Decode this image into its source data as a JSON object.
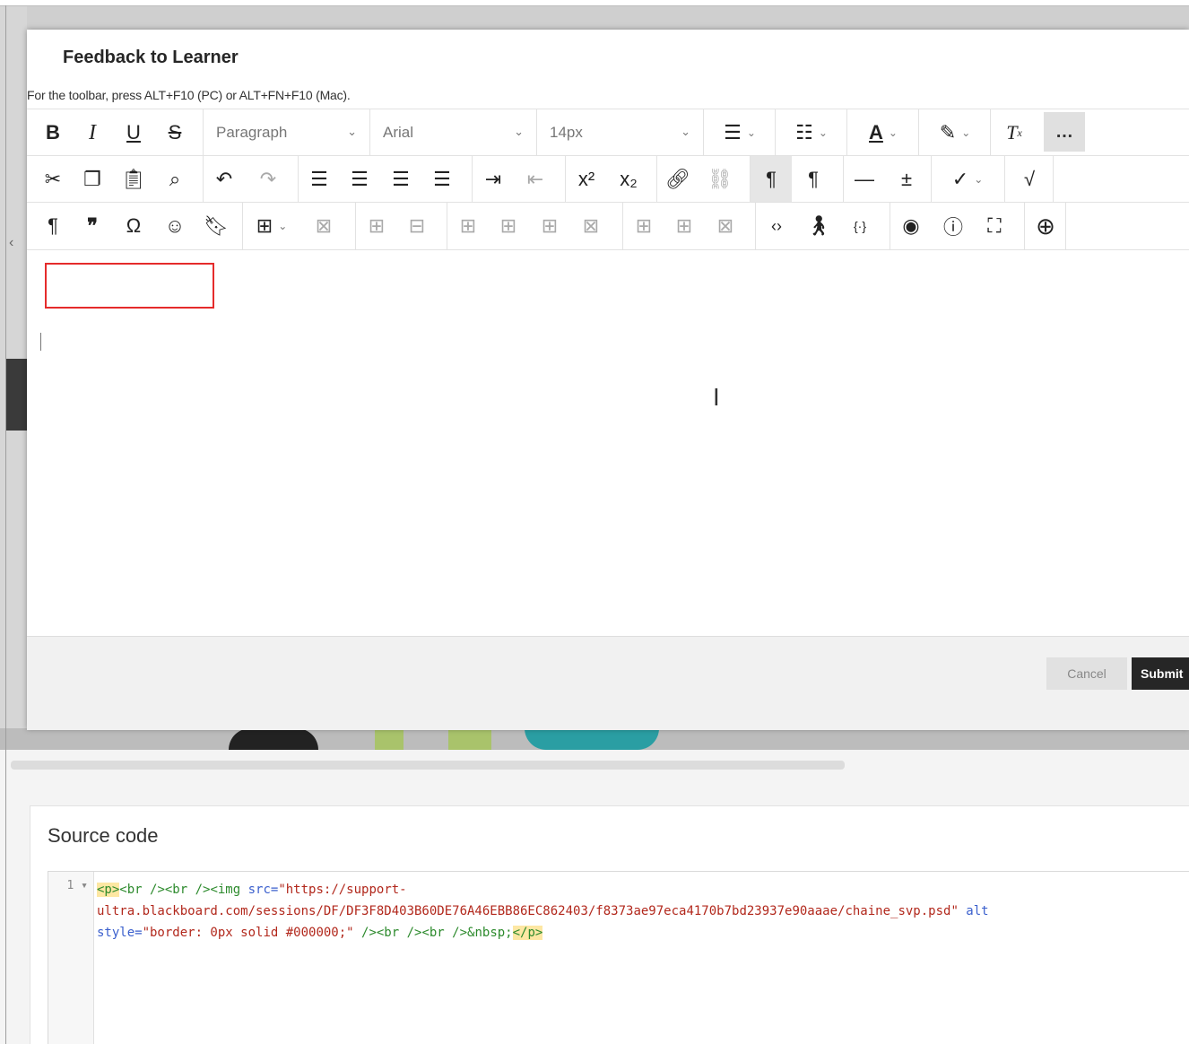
{
  "modal": {
    "title": "Feedback to Learner",
    "toolbar_hint": "For the toolbar, press ALT+F10 (PC) or ALT+FN+F10 (Mac).",
    "format_select": "Paragraph",
    "font_select": "Arial",
    "size_select": "14px",
    "more_label": "…",
    "cancel_label": "Cancel",
    "submit_label": "Submit"
  },
  "source": {
    "title": "Source code",
    "line_number": "1",
    "code": {
      "line1": {
        "open_p": "<p>",
        "br_tags": "<br /><br /><img ",
        "src_attr": "src=",
        "src_val_start": "\"https://support-"
      },
      "line2": {
        "src_val_end": "ultra.blackboard.com/sessions/DF/DF3F8D403B60DE76A46EBB86EC862403/f8373ae97eca4170b7bd23937e90aaae/chaine_svp.psd\"",
        "alt_attr": " alt"
      },
      "line3": {
        "style_attr": "style=",
        "style_val": "\"border: 0px solid #000000;\"",
        "close_img": " /><br /><br />",
        "nbsp": "&nbsp;",
        "close_p": "</p>"
      }
    }
  }
}
